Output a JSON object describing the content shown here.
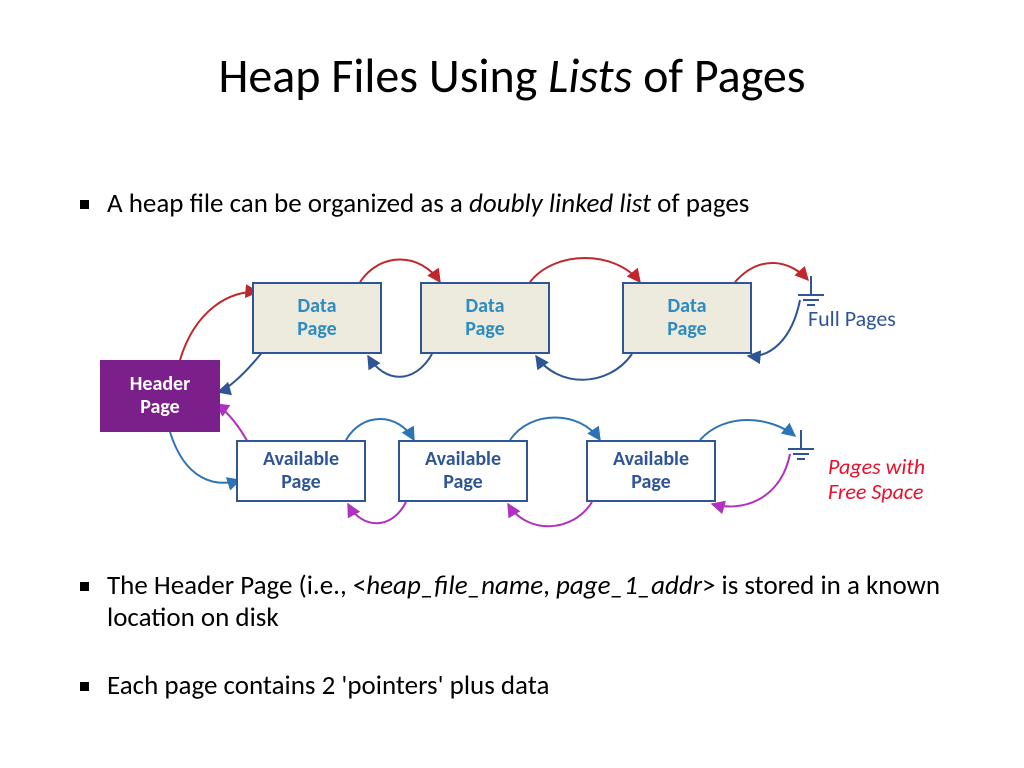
{
  "title": {
    "pre": "Heap Files Using ",
    "italic": "Lists",
    "post": " of Pages"
  },
  "bullets": {
    "b1_pre": "A heap file can be organized as a ",
    "b1_italic": "doubly linked list",
    "b1_post": " of pages",
    "b2_pre": "The Header Page (i.e., <",
    "b2_it1": "heap_file_name",
    "b2_mid": ", ",
    "b2_it2": "page_1_addr",
    "b2_post": "> is stored in a known location on disk",
    "b3": "Each page contains 2 'pointers' plus data"
  },
  "diagram": {
    "header": "Header Page",
    "data": "Data Page",
    "available": "Available Page",
    "full_label": "Full Pages",
    "free_label": "Pages with Free Space"
  },
  "chart_data": {
    "type": "diagram",
    "description": "Heap file organized as doubly linked lists of pages",
    "structure": {
      "header_page": {
        "label": "Header Page",
        "links_to": [
          "full_pages_list_head",
          "free_pages_list_head"
        ]
      },
      "full_pages_list": {
        "label": "Full Pages",
        "pages": [
          "Data Page",
          "Data Page",
          "Data Page"
        ],
        "doubly_linked": true,
        "terminated": true
      },
      "free_pages_list": {
        "label": "Pages with Free Space",
        "pages": [
          "Available Page",
          "Available Page",
          "Available Page"
        ],
        "doubly_linked": true,
        "terminated": true
      }
    },
    "arrow_colors": {
      "header_to_full": "red",
      "full_to_header": "darkblue",
      "full_forward": "red",
      "full_backward": "darkblue",
      "header_to_free": "blue",
      "free_to_header": "purple",
      "free_forward": "blue",
      "free_backward": "purple"
    }
  }
}
